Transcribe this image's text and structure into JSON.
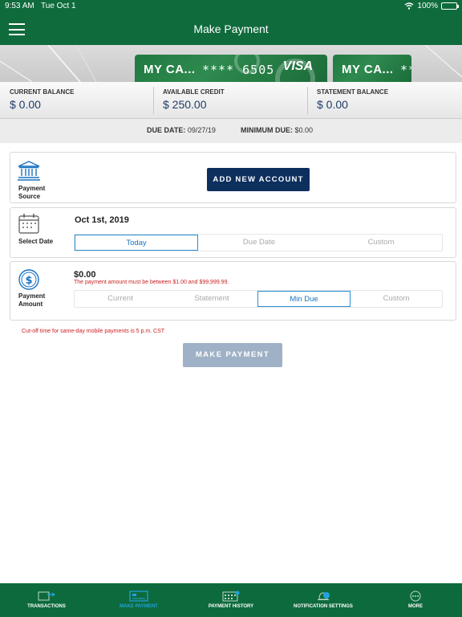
{
  "status": {
    "time": "9:53 AM",
    "date": "Tue Oct 1",
    "battery": "100%"
  },
  "header": {
    "title": "Make Payment"
  },
  "cards": [
    {
      "name": "MY CA...",
      "number": "**** 6505",
      "network": "VISA"
    },
    {
      "name": "MY CA...",
      "number": "**"
    }
  ],
  "balances": {
    "current_label": "CURRENT BALANCE",
    "current_value": "$ 0.00",
    "available_label": "AVAILABLE CREDIT",
    "available_value": "$ 250.00",
    "statement_label": "STATEMENT BALANCE",
    "statement_value": "$ 0.00"
  },
  "due": {
    "due_label": "DUE DATE:",
    "due_value": "09/27/19",
    "min_label": "MINIMUM DUE:",
    "min_value": "$0.00"
  },
  "source": {
    "label": "Payment Source",
    "button": "ADD NEW ACCOUNT"
  },
  "date": {
    "label": "Select Date",
    "value": "Oct 1st, 2019",
    "options": [
      "Today",
      "Due Date",
      "Custom"
    ],
    "selected": "Today"
  },
  "amount": {
    "label": "Payment Amount",
    "value": "$0.00",
    "error": "The payment amount must be between $1.00 and $99,999.99.",
    "options": [
      "Current",
      "Statement",
      "Min Due",
      "Custom"
    ],
    "selected": "Min Due"
  },
  "cutoff_note": "Cut-off time for same-day mobile payments is 5 p.m. CST",
  "make_payment_label": "MAKE PAYMENT",
  "tabs": [
    {
      "label": "TRANSACTIONS",
      "icon": "card-arrows-icon"
    },
    {
      "label": "MAKE PAYMENT",
      "icon": "payment-card-icon",
      "active": true
    },
    {
      "label": "PAYMENT HISTORY",
      "icon": "calendar-icon"
    },
    {
      "label": "NOTIFICATION SETTINGS",
      "icon": "bell-icon"
    },
    {
      "label": "MORE",
      "icon": "more-icon"
    }
  ],
  "colors": {
    "brand_green": "#0f6b3c",
    "navy": "#0d2f5e",
    "accent_blue": "#1a73c0",
    "error_red": "#cc2222"
  }
}
